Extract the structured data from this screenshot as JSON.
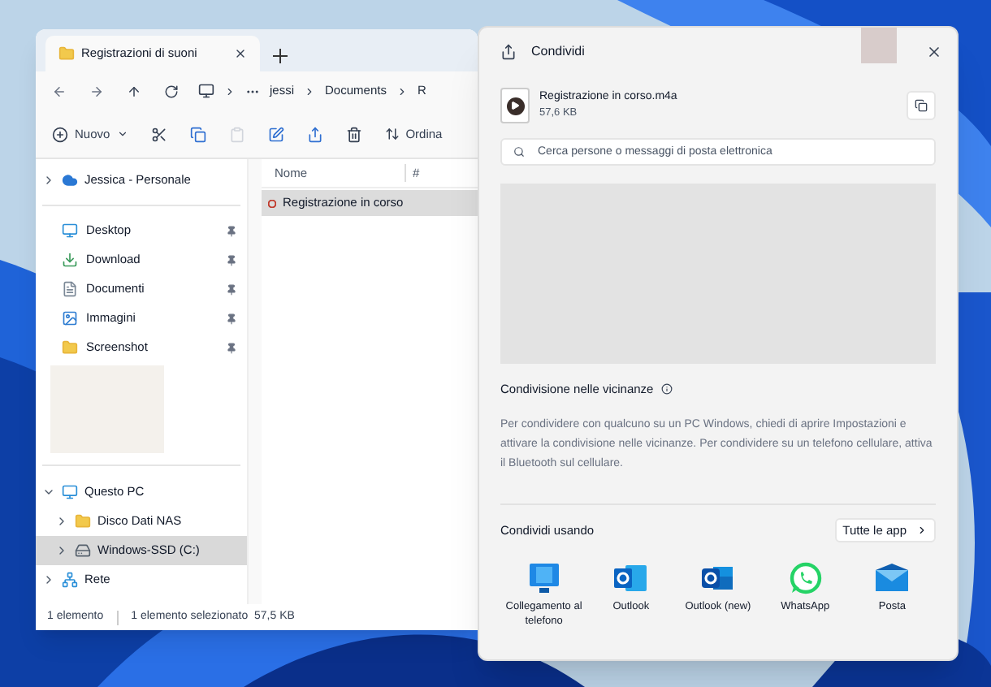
{
  "explorer": {
    "tab_title": "Registrazioni di suoni",
    "address": [
      "jessi",
      "Documents",
      "R"
    ],
    "toolbar": {
      "new_label": "Nuovo",
      "sort_label": "Ordina"
    },
    "cloud": {
      "label": "Jessica - Personale",
      "expanded": false
    },
    "quick_access": [
      {
        "label": "Desktop"
      },
      {
        "label": "Download"
      },
      {
        "label": "Documenti"
      },
      {
        "label": "Immagini"
      },
      {
        "label": "Screenshot"
      }
    ],
    "tree": [
      {
        "label": "Questo PC",
        "expanded": true,
        "selected": false,
        "children": [
          {
            "label": "Disco Dati NAS",
            "expanded": false,
            "selected": false
          },
          {
            "label": "Windows-SSD (C:)",
            "expanded": false,
            "selected": true
          }
        ]
      },
      {
        "label": "Rete",
        "expanded": false,
        "selected": false
      }
    ],
    "columns": [
      "Nome",
      "#"
    ],
    "files": [
      {
        "name": "Registrazione in corso",
        "selected": true
      }
    ],
    "status": [
      "1 elemento",
      "1 elemento selezionato  57,5 KB"
    ]
  },
  "share": {
    "title": "Condividi",
    "file": {
      "name": "Registrazione in corso.m4a",
      "size": "57,6 KB"
    },
    "search": {
      "placeholder": "Cerca persone o messaggi di posta elettronica"
    },
    "nearby": {
      "title": "Condivisione nelle vicinanze",
      "text": "Per condividere con qualcuno su un PC Windows, chiedi di aprire Impostazioni e attivare la condivisione nelle vicinanze. Per condividere su un telefono cellulare, attiva il Bluetooth sul cellulare."
    },
    "using": {
      "title": "Condividi usando",
      "all_apps": "Tutte le app"
    },
    "apps": [
      {
        "label": "Collegamento al telefono"
      },
      {
        "label": "Outlook"
      },
      {
        "label": "Outlook (new)"
      },
      {
        "label": "WhatsApp"
      },
      {
        "label": "Posta"
      }
    ]
  }
}
